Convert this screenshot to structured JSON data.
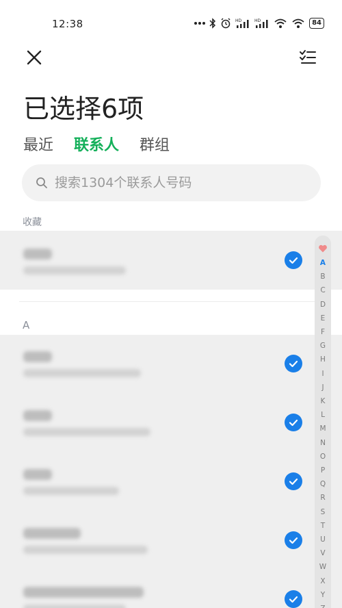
{
  "status_bar": {
    "time": "12:38",
    "battery": "84",
    "icons": [
      "dots-icon",
      "bluetooth-icon",
      "alarm-icon",
      "hd-signal-icon",
      "hd-signal-icon",
      "wifi-icon",
      "wifi-icon"
    ]
  },
  "toolbar": {
    "close_icon": "close-icon",
    "select_all_icon": "checklist-icon"
  },
  "page_title": "已选择6项",
  "tabs": [
    {
      "label": "最近",
      "active": false
    },
    {
      "label": "联系人",
      "active": true
    },
    {
      "label": "群组",
      "active": false
    }
  ],
  "search": {
    "placeholder": "搜索1304个联系人号码"
  },
  "sections": [
    {
      "label": "收藏"
    },
    {
      "label": "A"
    }
  ],
  "contacts": [
    {
      "section": "收藏",
      "name": "",
      "number": "",
      "selected": true
    },
    {
      "section": "A",
      "name": "",
      "number": "",
      "selected": true
    },
    {
      "section": "A",
      "name": "",
      "number": "",
      "selected": true
    },
    {
      "section": "A",
      "name": "",
      "number": "",
      "selected": true
    },
    {
      "section": "A",
      "name": "",
      "number": "",
      "selected": true
    },
    {
      "section": "A",
      "name": "",
      "number": "",
      "selected": true
    }
  ],
  "index_bar": {
    "favorite_icon": "heart-icon",
    "letters": [
      "A",
      "B",
      "C",
      "D",
      "E",
      "F",
      "G",
      "H",
      "I",
      "J",
      "K",
      "L",
      "M",
      "N",
      "O",
      "P",
      "Q",
      "R",
      "S",
      "T",
      "U",
      "V",
      "W",
      "X",
      "Y",
      "Z"
    ],
    "active_letter": "A"
  },
  "colors": {
    "accent_green": "#14b05a",
    "check_blue": "#1a7fe8",
    "heart_pink": "#f08a8a"
  }
}
